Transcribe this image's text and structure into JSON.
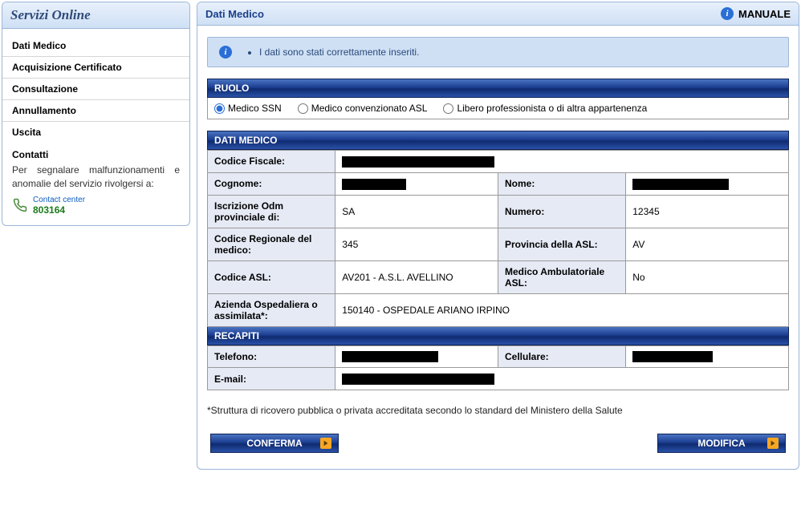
{
  "sidebar": {
    "title": "Servizi Online",
    "items": [
      {
        "label": "Dati Medico"
      },
      {
        "label": "Acquisizione Certificato"
      },
      {
        "label": "Consultazione"
      },
      {
        "label": "Annullamento"
      },
      {
        "label": "Uscita"
      }
    ],
    "contatti": {
      "heading": "Contatti",
      "text": "Per segnalare malfunzionamenti e anomalie del servizio rivolgersi a:",
      "contact_label": "Contact center",
      "contact_number": "803164"
    }
  },
  "header": {
    "title": "Dati Medico",
    "manual_label": "MANUALE"
  },
  "info_banner": {
    "message": "I dati sono stati correttamente inseriti."
  },
  "ruolo": {
    "section_label": "RUOLO",
    "options": [
      {
        "label": "Medico SSN",
        "checked": true
      },
      {
        "label": "Medico convenzionato ASL",
        "checked": false
      },
      {
        "label": "Libero professionista o di altra appartenenza",
        "checked": false
      }
    ]
  },
  "dati_medico": {
    "section_label": "DATI MEDICO",
    "codice_fiscale_label": "Codice Fiscale:",
    "codice_fiscale_value": "",
    "cognome_label": "Cognome:",
    "cognome_value": "",
    "nome_label": "Nome:",
    "nome_value": "",
    "iscrizione_odm_label": "Iscrizione Odm provinciale di:",
    "iscrizione_odm_value": "SA",
    "numero_label": "Numero:",
    "numero_value": "12345",
    "codice_regionale_label": "Codice Regionale del medico:",
    "codice_regionale_value": "345",
    "provincia_asl_label": "Provincia della ASL:",
    "provincia_asl_value": "AV",
    "codice_asl_label": "Codice ASL:",
    "codice_asl_value": "AV201 - A.S.L. AVELLINO",
    "medico_amb_label": "Medico Ambulatoriale ASL:",
    "medico_amb_value": "No",
    "azienda_osp_label": "Azienda Ospedaliera o assimilata*:",
    "azienda_osp_value": "150140 - OSPEDALE ARIANO IRPINO"
  },
  "recapiti": {
    "section_label": "RECAPITI",
    "telefono_label": "Telefono:",
    "telefono_value": "",
    "cellulare_label": "Cellulare:",
    "cellulare_value": "",
    "email_label": "E-mail:",
    "email_value": ""
  },
  "footnote": "*Struttura di ricovero pubblica o privata accreditata secondo lo standard del Ministero della Salute",
  "buttons": {
    "conferma": "CONFERMA",
    "modifica": "MODIFICA"
  }
}
